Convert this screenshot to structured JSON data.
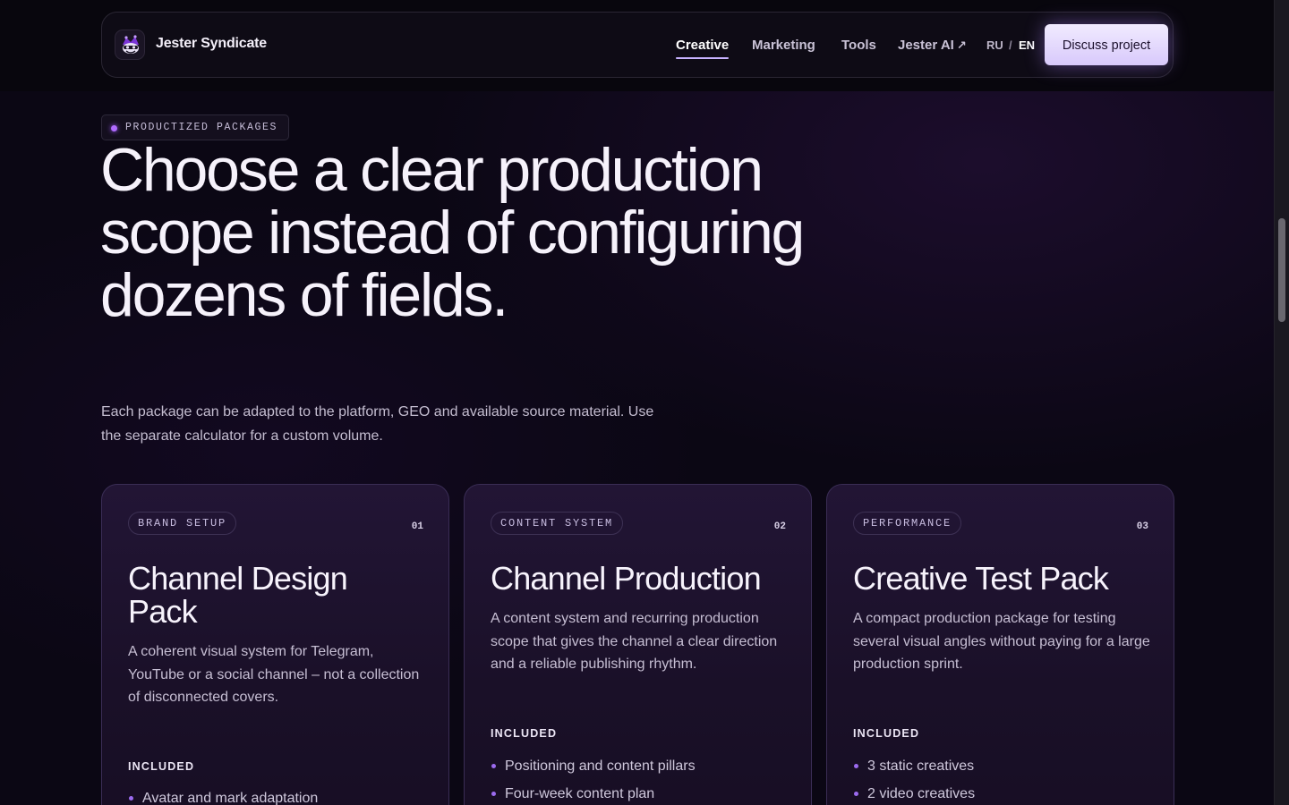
{
  "header": {
    "brand_name": "Jester Syndicate",
    "logo_icon": "jester-hat-icon",
    "nav": [
      {
        "label": "Creative",
        "active": true
      },
      {
        "label": "Marketing",
        "active": false
      },
      {
        "label": "Tools",
        "active": false
      },
      {
        "label": "Jester AI",
        "active": false,
        "external": true
      }
    ],
    "external_icon": "↗",
    "lang": {
      "ru": "RU",
      "separator": "/",
      "en": "EN",
      "active": "EN"
    },
    "cta_label": "Discuss project"
  },
  "hero": {
    "eyebrow": "PRODUCTIZED PACKAGES",
    "headline": "Choose a clear production scope instead of configuring dozens of fields.",
    "subtitle": "Each package can be adapted to the platform, GEO and available source material. Use the separate calculator for a custom volume."
  },
  "packages": [
    {
      "chip": "BRAND SETUP",
      "number": "01",
      "title": "Channel Design Pack",
      "description": "A coherent visual system for Telegram, YouTube or a social channel – not a collection of disconnected covers.",
      "included_label": "INCLUDED",
      "items": [
        "Avatar and mark adaptation"
      ]
    },
    {
      "chip": "CONTENT SYSTEM",
      "number": "02",
      "title": "Channel Production",
      "description": "A content system and recurring production scope that gives the channel a clear direction and a reliable publishing rhythm.",
      "included_label": "INCLUDED",
      "items": [
        "Positioning and content pillars",
        "Four-week content plan"
      ]
    },
    {
      "chip": "PERFORMANCE",
      "number": "03",
      "title": "Creative Test Pack",
      "description": "A compact production package for testing several visual angles without paying for a large production sprint.",
      "included_label": "INCLUDED",
      "items": [
        "3 static creatives",
        "2 video creatives"
      ]
    }
  ],
  "colors": {
    "background": "#0b0714",
    "accent": "#b06bff",
    "cta": "#e6dcff",
    "card": "#1d1230"
  }
}
